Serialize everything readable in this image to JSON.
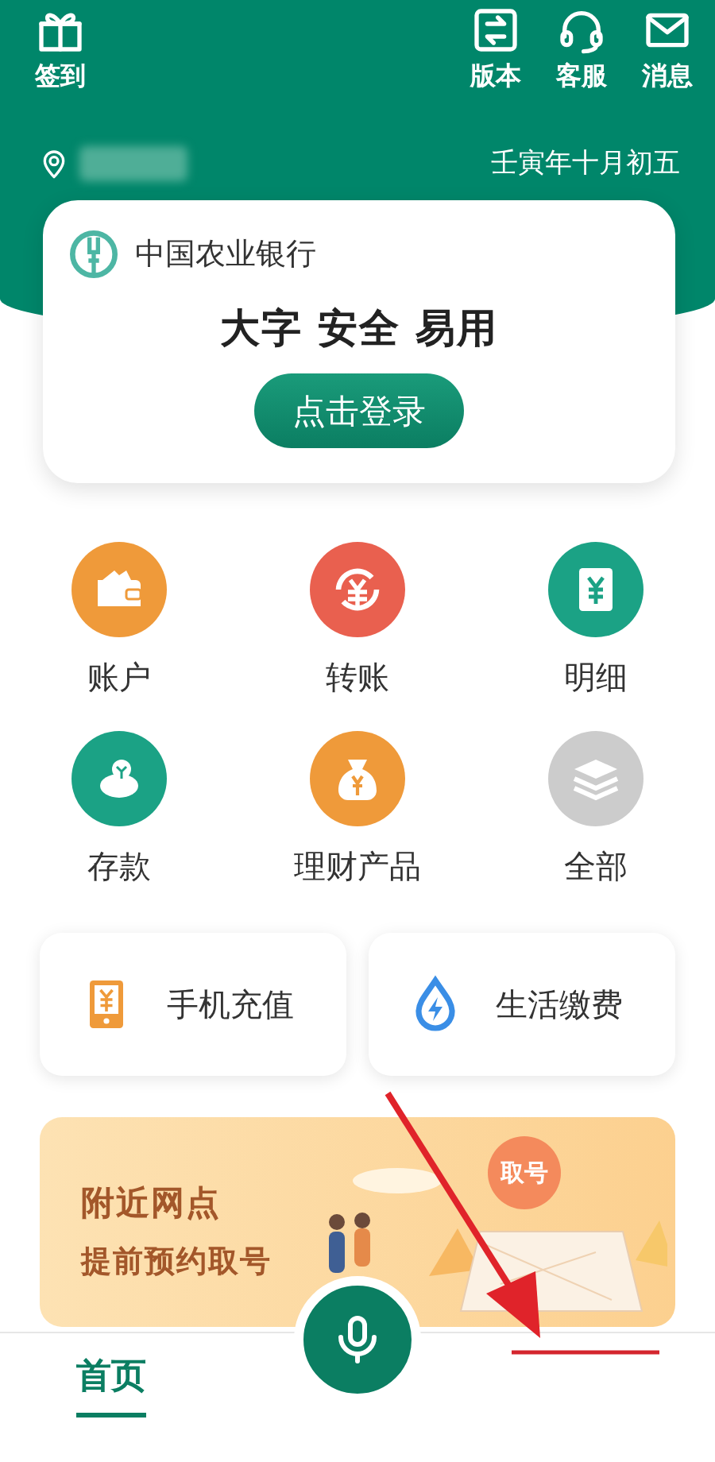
{
  "header": {
    "left_action": {
      "label": "签到"
    },
    "right_actions": [
      {
        "label": "版本"
      },
      {
        "label": "客服"
      },
      {
        "label": "消息"
      }
    ],
    "lunar_date": "壬寅年十月初五"
  },
  "login_card": {
    "bank_name": "中国农业银行",
    "slogan": "大字 安全 易用",
    "login_button": "点击登录"
  },
  "features": [
    {
      "label": "账户",
      "color": "#ef9a3a"
    },
    {
      "label": "转账",
      "color": "#e9604f"
    },
    {
      "label": "明细",
      "color": "#1ba285"
    },
    {
      "label": "存款",
      "color": "#1ba285"
    },
    {
      "label": "理财产品",
      "color": "#ef9a3a"
    },
    {
      "label": "全部",
      "color": "#cccccc"
    }
  ],
  "services": [
    {
      "label": "手机充值"
    },
    {
      "label": "生活缴费"
    }
  ],
  "banner": {
    "title": "附近网点",
    "subtitle": "提前预约取号",
    "pin_label": "取号"
  },
  "bottom_nav": {
    "tabs": [
      {
        "label": "首页",
        "selected": true
      }
    ]
  }
}
